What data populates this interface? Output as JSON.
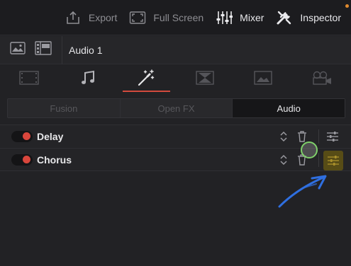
{
  "toolbar": {
    "export_label": "Export",
    "fullscreen_label": "Full Screen",
    "mixer_label": "Mixer",
    "inspector_label": "Inspector"
  },
  "clip": {
    "name": "Audio 1"
  },
  "category_tabs": [
    "video-frame",
    "music-note",
    "effects-wand",
    "transition",
    "image",
    "camera"
  ],
  "segment": {
    "items": [
      {
        "label": "Fusion",
        "active": false
      },
      {
        "label": "Open FX",
        "active": false
      },
      {
        "label": "Audio",
        "active": true
      }
    ]
  },
  "effects": [
    {
      "name": "Delay",
      "enabled": true
    },
    {
      "name": "Chorus",
      "enabled": true
    }
  ],
  "colors": {
    "accent": "#d24a3d",
    "notification_dot": "#e08a2e",
    "highlight": "#826e0a",
    "annotation_arrow": "#2f6fe0",
    "cursor_ring": "#7fd06a"
  }
}
